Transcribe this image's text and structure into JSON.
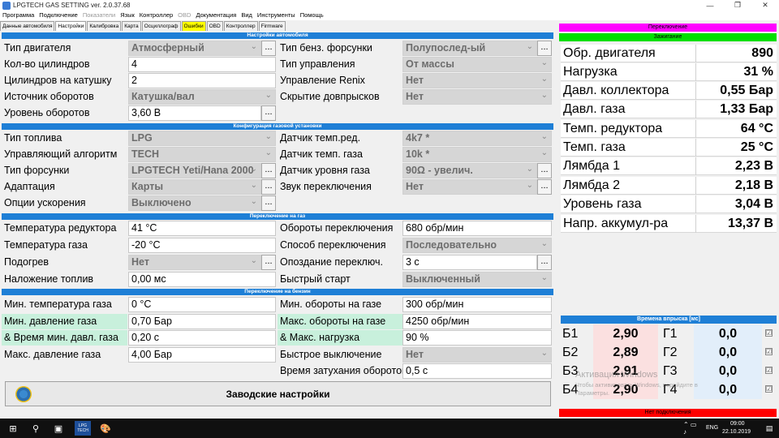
{
  "window": {
    "title": "LPGTECH GAS SETTING ver. 2.0.37.68",
    "minimize": "—",
    "maximize": "❐",
    "close": "✕"
  },
  "menu": [
    {
      "label": "Программа",
      "enabled": true
    },
    {
      "label": "Подключение",
      "enabled": true
    },
    {
      "label": "Показатели",
      "enabled": false
    },
    {
      "label": "Язык",
      "enabled": true
    },
    {
      "label": "Контроллер",
      "enabled": true
    },
    {
      "label": "OBD",
      "enabled": false
    },
    {
      "label": "Документация",
      "enabled": true
    },
    {
      "label": "Вид",
      "enabled": true
    },
    {
      "label": "Инструменты",
      "enabled": true
    },
    {
      "label": "Помощь",
      "enabled": true
    }
  ],
  "tabs": [
    "Данные автомобиля",
    "Настройки",
    "Калибровка",
    "Карта",
    "Осциллограф",
    "Ошибки",
    "OBD",
    "Контроллер",
    "Firmware"
  ],
  "sections": {
    "car": "Настройки автомобиля",
    "gas": "Конфигурация газовой установки",
    "switch_gas": "Переключение на газ",
    "switch_petrol": "Переключение на бензин"
  },
  "car": {
    "engine_type_label": "Тип двигателя",
    "engine_type": "Атмосферный",
    "cylinders_label": "Кол-во цилиндров",
    "cylinders": "4",
    "cyl_per_coil_label": "Цилиндров на катушку",
    "cyl_per_coil": "2",
    "rpm_source_label": "Источник оборотов",
    "rpm_source": "Катушка/вал",
    "rpm_level_label": "Уровень оборотов",
    "rpm_level": "3,60 В",
    "petrol_inj_label": "Тип бенз. форсунки",
    "petrol_inj": "Полупослед-ый",
    "control_type_label": "Тип управления",
    "control_type": "От массы",
    "renix_label": "Управление Renix",
    "renix": "Нет",
    "hide_extra_label": "Скрытие довпрысков",
    "hide_extra": "Нет"
  },
  "gas": {
    "fuel_type_label": "Тип топлива",
    "fuel_type": "LPG",
    "algorithm_label": "Управляющий алгоритм",
    "algorithm": "TECH",
    "injector_label": "Тип форсунки",
    "injector": "LPGTECH Yeti/Hana 2000",
    "adaptation_label": "Адаптация",
    "adaptation": "Карты",
    "accel_label": "Опции ускорения",
    "accel": "Выключено",
    "red_temp_sensor_label": "Датчик темп.ред.",
    "red_temp_sensor": "4k7 *",
    "gas_temp_sensor_label": "Датчик темп. газа",
    "gas_temp_sensor": "10k *",
    "level_sensor_label": "Датчик уровня газа",
    "level_sensor": "90Ω - увелич.",
    "switch_sound_label": "Звук переключения",
    "switch_sound": "Нет"
  },
  "switch_gas": {
    "red_temp_label": "Температура редуктора",
    "red_temp": "41 °C",
    "gas_temp_label": "Температура газа",
    "gas_temp": "-20 °C",
    "heating_label": "Подогрев",
    "heating": "Нет",
    "overlap_label": "Наложение топлив",
    "overlap": "0,00 мс",
    "switch_rpm_label": "Обороты переключения",
    "switch_rpm": "680 обр/мин",
    "switch_method_label": "Способ переключения",
    "switch_method": "Последовательно",
    "switch_delay_label": "Опоздание переключ.",
    "switch_delay": "3 с",
    "fast_start_label": "Быстрый старт",
    "fast_start": "Выключенный"
  },
  "switch_petrol": {
    "min_gas_temp_label": "Мин. температура газа",
    "min_gas_temp": "0 °C",
    "min_gas_press_label": "Мин. давление газа",
    "min_gas_press": "0,70 Бар",
    "min_press_time_label": "& Время мин. давл. газа",
    "min_press_time": "0,20 с",
    "max_gas_press_label": "Макс. давление газа",
    "max_gas_press": "4,00 Бар",
    "min_rpm_label": "Мин. обороты на газе",
    "min_rpm": "300 обр/мин",
    "max_rpm_label": "Макс. обороты на газе",
    "max_rpm": "4250 обр/мин",
    "max_load_label": "& Макс. нагрузка",
    "max_load": "90 %",
    "fast_off_label": "Быстрое выключение",
    "fast_off": "Нет",
    "rpm_decay_label": "Время затухания оборотов",
    "rpm_decay": "0,5 с"
  },
  "ellipsis": "...",
  "factory_button": "Заводские настройки",
  "right": {
    "switch_banner": "Переключение",
    "ignition_banner": "Зажигание",
    "params": [
      {
        "label": "Обр. двигателя",
        "value": "890"
      },
      {
        "label": "Нагрузка",
        "value": "31 %"
      },
      {
        "label": "Давл. коллектора",
        "value": "0,55 Бар"
      },
      {
        "label": "Давл. газа",
        "value": "1,33 Бар"
      },
      {
        "label": "Темп. редуктора",
        "value": "64 °C"
      },
      {
        "label": "Темп. газа",
        "value": "25 °C"
      },
      {
        "label": "Лямбда 1",
        "value": "2,23 В"
      },
      {
        "label": "Лямбда 2",
        "value": "2,18 В"
      },
      {
        "label": "Уровень газа",
        "value": "3,04 В"
      },
      {
        "label": "Напр. аккумул-ра",
        "value": "13,37 В"
      }
    ],
    "injection_header": "Времена впрыска [мс]",
    "injection": [
      {
        "b": "Б1",
        "bv": "2,90",
        "g": "Г1",
        "gv": "0,0"
      },
      {
        "b": "Б2",
        "bv": "2,89",
        "g": "Г2",
        "gv": "0,0"
      },
      {
        "b": "Б3",
        "bv": "2,91",
        "g": "Г3",
        "gv": "0,0"
      },
      {
        "b": "Б4",
        "bv": "2,90",
        "g": "Г4",
        "gv": "0,0"
      }
    ],
    "check_mark": "☑",
    "not_connected": "Нет подключения",
    "watermark_1": "Активация Windows",
    "watermark_2": "Чтобы активировать Windows, перейдите в",
    "watermark_3": "Параметры."
  },
  "taskbar": {
    "time": "09:00",
    "date": "22.10.2019",
    "lang": "ENG",
    "app_label": "LPG TECH"
  },
  "colors": {
    "section_blue": "#1e7fd6",
    "switch_magenta": "#ff00ff",
    "ignition_green": "#00e000",
    "not_connected_red": "#ff0000"
  }
}
